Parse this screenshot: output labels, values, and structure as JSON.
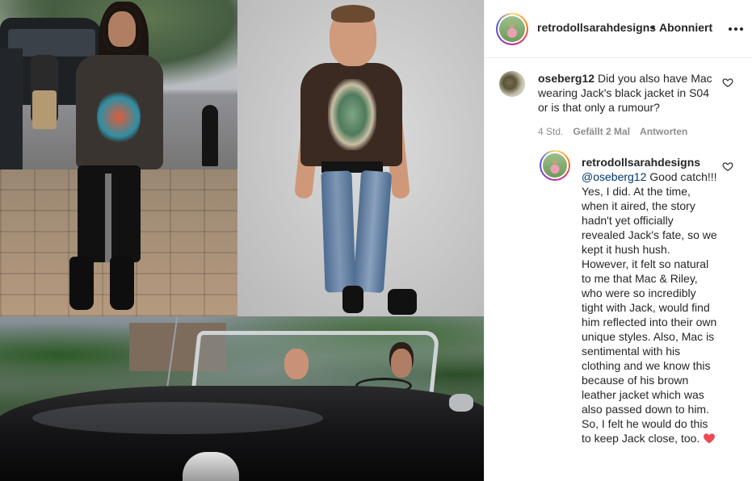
{
  "post": {
    "username": "retrodollsarahdesigns",
    "separator": "•",
    "follow_status": "Abonniert",
    "more_icon": "more-horizontal-icon"
  },
  "comments": [
    {
      "username": "oseberg12",
      "text": "Did you also have Mac wearing Jack's black jacket in S04 or is that only a rumour?",
      "time": "4 Std.",
      "likes": "Gefällt 2 Mal",
      "reply_label": "Antworten"
    },
    {
      "username": "retrodollsarahdesigns",
      "mention": "@oseberg12",
      "text": " Good catch!!! Yes, I did. At the time, when it aired, the story hadn't yet officially revealed Jack's fate, so we kept it hush hush. However, it felt so natural to me that Mac & Riley, who were so incredibly tight with Jack, would find him reflected into their own unique styles. Also, Mac is sentimental with his clothing and we know this because of his brown leather jacket which was also passed down to him. So, I felt he would do this to keep Jack close, too.",
      "emoji": "red-heart"
    }
  ],
  "colors": {
    "text": "#262626",
    "meta": "#8e8e8e",
    "mention": "#00376b",
    "heart": "#ed4956",
    "border": "#efefef"
  }
}
